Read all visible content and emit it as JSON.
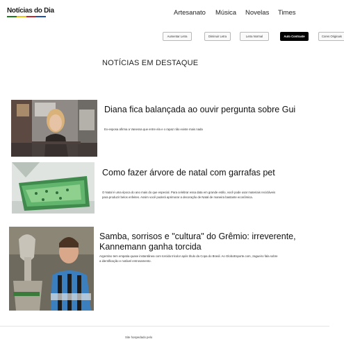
{
  "header": {
    "logo_text": "Notícias do Dia",
    "logo_colors": [
      "#1f7a1f",
      "#e8c41a",
      "#c0262d",
      "#1f4fa8"
    ]
  },
  "nav": {
    "items": [
      "Artesanato",
      "Música",
      "Novelas",
      "Times"
    ]
  },
  "toolbar": {
    "buttons": [
      "Aumentar Letra",
      "Diminuir Letra",
      "Letra Normal",
      "Auto Contraste",
      "Cores Originais"
    ],
    "active_index": 3
  },
  "main": {
    "section_title": "NOTÍCIAS EM DESTAQUE",
    "articles": [
      {
        "image": "woman-at-desk-photo",
        "headline": "Diana fica balançada ao ouvir pergunta sobre Gui",
        "summary": "Ex-esposa afirma a Vanessa que entre ela e o rapaz não existe mais nada"
      },
      {
        "image": "christmas-tree-bottles-photo",
        "headline": "Como fazer árvore de natal com garrafas pet",
        "summary": "O Natal é uma época do ano mais do que especial. Para celebrar essa data em grande estilo, você pode usar materiais recicláveis para produzir belos enfeites. Assim você poderá aprimorar a decoração de Natal de maneira bastante econômica."
      },
      {
        "image": "football-player-trophy-photo",
        "headline": "Samba, sorrisos e \"cultura\" do Grêmio: irreverente, Kannemann ganha torcida",
        "summary": "Argentino tem empatia quase instantânea com torcida tricolor após título da Copa do Brasil. Ao GloboEsporte.com, zagueiro fala sobre a identificação e notável entrosamento."
      }
    ]
  },
  "footer": {
    "text": "Site hospedado pelo"
  }
}
